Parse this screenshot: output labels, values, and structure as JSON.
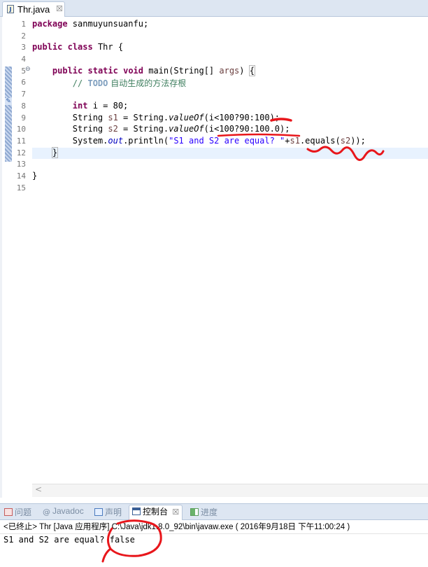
{
  "editor": {
    "tab": {
      "icon": "java-file-icon",
      "title": "Thr.java",
      "close_icon": "close-icon"
    },
    "line_numbers": [
      "1",
      "2",
      "3",
      "4",
      "5",
      "6",
      "7",
      "8",
      "9",
      "10",
      "11",
      "12",
      "13",
      "14",
      "15"
    ],
    "fold_marker": "⊖",
    "code": {
      "l1_kw": "package",
      "l1_text": " sanmuyunsuanfu;",
      "l3_kw1": "public",
      "l3_kw2": "class",
      "l3_text": " Thr {",
      "l5_kw1": "public",
      "l5_kw2": "static",
      "l5_kw3": "void",
      "l5_text1": " main(String[] ",
      "l5_arg": "args",
      "l5_text2": ") ",
      "l5_brace": "{",
      "l6_slashes": "// ",
      "l6_todo": "TODO",
      "l6_comment": " 自动生成的方法存根",
      "l8_kw": "int",
      "l8_text": " i = 80;",
      "l9_a": "String ",
      "l9_var": "s1",
      "l9_b": " = String.",
      "l9_m": "valueOf",
      "l9_c": "(i<100?90:100);",
      "l10_a": "String ",
      "l10_var": "s2",
      "l10_b": " = String.",
      "l10_m": "valueOf",
      "l10_c": "(i<100?90:100.0);",
      "l11_a": "System.",
      "l11_out": "out",
      "l11_b": ".println(",
      "l11_str": "\"S1 and S2 are equal? \"",
      "l11_c": "+",
      "l11_s1": "s1",
      "l11_d": ".equals(",
      "l11_s2": "s2",
      "l11_e": "));",
      "l12_text": "}",
      "l14_text": "}"
    },
    "hscroll_arrow": "<"
  },
  "views": {
    "tabs": [
      {
        "label": "问题",
        "icon": "problems-icon"
      },
      {
        "label": "Javadoc",
        "icon": "at-icon"
      },
      {
        "label": "声明",
        "icon": "declaration-icon"
      },
      {
        "label": "控制台",
        "icon": "console-icon",
        "active": true
      },
      {
        "label": "进度",
        "icon": "progress-icon"
      }
    ],
    "close_icon_glyph": "☒",
    "at_glyph": "@"
  },
  "console": {
    "status": "<已终止> Thr [Java 应用程序] C:\\Java\\jdk1.8.0_92\\bin\\javaw.exe ( 2016年9月18日 下午11:00:24 )",
    "output": "S1 and S2 are equal? false"
  },
  "annotation": {
    "color": "#e8161b"
  },
  "colors": {
    "keyword": "#7f0055",
    "comment": "#3f7f5f",
    "string": "#2a00ff",
    "field": "#0000c0",
    "current_line": "#e8f2fe",
    "tab_bar": "#dde6f2"
  }
}
